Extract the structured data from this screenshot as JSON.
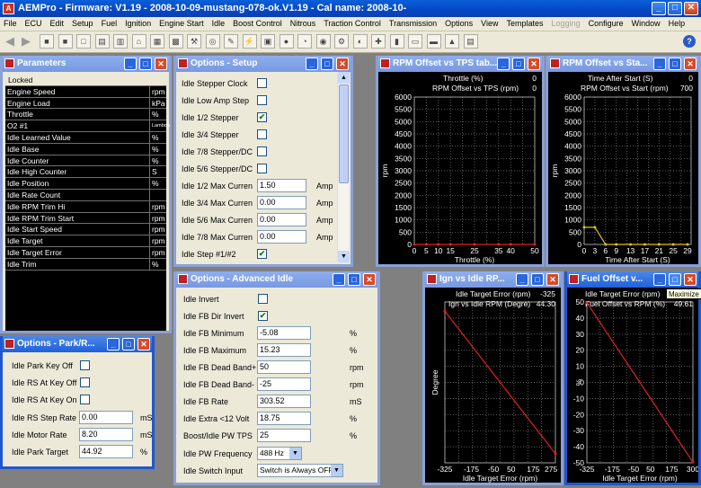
{
  "app": {
    "title": "AEMPro - Firmware: V1.19 - 2008-10-09-mustang-078-ok.V1.19 - Cal name: 2008-10-",
    "menu": [
      "File",
      "ECU",
      "Edit",
      "Setup",
      "Fuel",
      "Ignition",
      "Engine Start",
      "Idle",
      "Boost Control",
      "Nitrous",
      "Traction Control",
      "Transmission",
      "Options",
      "View",
      "Templates",
      "Logging",
      "Configure",
      "Window",
      "Help"
    ],
    "menu_disabled": "Logging",
    "tooltip": "Maximize"
  },
  "parameters": {
    "title": "Parameters",
    "header": "Locked",
    "rows": [
      {
        "name": "Engine Speed",
        "unit": "rpm"
      },
      {
        "name": "Engine Load",
        "unit": "kPa"
      },
      {
        "name": "Throttle",
        "unit": "%"
      },
      {
        "name": "O2 #1",
        "unit": "Lambda"
      },
      {
        "name": "Idle Learned Value",
        "unit": "%"
      },
      {
        "name": "Idle Base",
        "unit": "%"
      },
      {
        "name": "Idle Counter",
        "unit": "%"
      },
      {
        "name": "Idle High Counter",
        "unit": "S"
      },
      {
        "name": "Idle Position",
        "unit": "%"
      },
      {
        "name": "Idle Rate Count",
        "unit": ""
      },
      {
        "name": "Idle RPM Trim Hi",
        "unit": "rpm"
      },
      {
        "name": "Idle RPM Trim Start",
        "unit": "rpm"
      },
      {
        "name": "Idle Start Speed",
        "unit": "rpm"
      },
      {
        "name": "Idle Target",
        "unit": "rpm"
      },
      {
        "name": "Idle Target Error",
        "unit": "rpm"
      },
      {
        "name": "Idle Trim",
        "unit": "%"
      }
    ]
  },
  "setup": {
    "title": "Options - Setup",
    "checks": [
      {
        "label": "Idle Stepper Clock",
        "checked": ""
      },
      {
        "label": "Idle Low Amp Step",
        "checked": ""
      },
      {
        "label": "Idle 1/2 Stepper",
        "checked": "✔"
      },
      {
        "label": "Idle 3/4 Stepper",
        "checked": ""
      },
      {
        "label": "Idle 7/8 Stepper/DC",
        "checked": ""
      },
      {
        "label": "Idle 5/6 Stepper/DC",
        "checked": ""
      }
    ],
    "fields": [
      {
        "label": "Idle 1/2 Max Curren",
        "value": "1.50",
        "unit": "Amp"
      },
      {
        "label": "Idle 3/4 Max Curren",
        "value": "0.00",
        "unit": "Amp"
      },
      {
        "label": "Idle 5/6 Max Curren",
        "value": "0.00",
        "unit": "Amp"
      },
      {
        "label": "Idle 7/8 Max Curren",
        "value": "0.00",
        "unit": "Amp"
      }
    ],
    "last": {
      "label": "Idle Step #1/#2",
      "checked": "✔"
    }
  },
  "park": {
    "title": "Options - Park/R...",
    "checks": [
      {
        "label": "Idle Park Key Off",
        "checked": ""
      },
      {
        "label": "Idle RS At Key Off",
        "checked": ""
      },
      {
        "label": "Idle RS At Key On",
        "checked": ""
      }
    ],
    "fields": [
      {
        "label": "Idle RS Step Rate",
        "value": "0.00",
        "unit": "mS"
      },
      {
        "label": "Idle Motor Rate",
        "value": "8.20",
        "unit": "mS"
      },
      {
        "label": "Idle Park Target",
        "value": "44.92",
        "unit": "%"
      }
    ]
  },
  "advanced": {
    "title": "Options - Advanced Idle",
    "checks": [
      {
        "label": "Idle Invert",
        "checked": ""
      },
      {
        "label": "Idle FB Dir Invert",
        "checked": "✔"
      }
    ],
    "fields": [
      {
        "label": "Idle FB Minimum",
        "value": "-5.08",
        "unit": "%"
      },
      {
        "label": "Idle FB Maximum",
        "value": "15.23",
        "unit": "%"
      },
      {
        "label": "Idle FB Dead Band+",
        "value": "50",
        "unit": "rpm"
      },
      {
        "label": "Idle FB Dead Band-",
        "value": "-25",
        "unit": "rpm"
      },
      {
        "label": "Idle FB Rate",
        "value": "303.52",
        "unit": "mS"
      },
      {
        "label": "Idle Extra <12 Volt",
        "value": "18.75",
        "unit": "%"
      },
      {
        "label": "Boost/Idle PW TPS",
        "value": "25",
        "unit": "%"
      }
    ],
    "freq": {
      "label": "Idle PW Frequency",
      "value": "488 Hz"
    },
    "switch": {
      "label": "Idle Switch Input",
      "value": "Switch is Always OFF"
    }
  },
  "charts": {
    "rpm_tps": {
      "title": "RPM Offset vs TPS tab...",
      "top_label": "Throttle (%)",
      "top_value": "0",
      "sub_label": "RPM Offset vs TPS (rpm)",
      "sub_value": "0",
      "ylabel": "rpm",
      "xlabel": "Throttle (%)",
      "yticks": [
        "6000",
        "5500",
        "5000",
        "4500",
        "4000",
        "3500",
        "3000",
        "2500",
        "2000",
        "1500",
        "1000",
        "500",
        "0"
      ],
      "xticks": [
        "0",
        "5",
        "10",
        "15",
        "25",
        "35",
        "40",
        "50"
      ]
    },
    "rpm_start": {
      "title": "RPM Offset vs Sta...",
      "top_label": "Time After Start (S)",
      "top_value": "0",
      "sub_label": "RPM Offset vs Start (rpm)",
      "sub_value": "700",
      "ylabel": "rpm",
      "xlabel": "Time After Start (S)",
      "yticks": [
        "6000",
        "5500",
        "5000",
        "4500",
        "4000",
        "3500",
        "3000",
        "2500",
        "2000",
        "1500",
        "1000",
        "500",
        "0"
      ],
      "xticks": [
        "0",
        "3",
        "6",
        "9",
        "13",
        "17",
        "21",
        "25",
        "29"
      ]
    },
    "ign": {
      "title": "Ign vs Idle RP...",
      "top_label": "Idle Target Error (rpm)",
      "top_value": "-325",
      "sub_label": "Ign vs Idle RPM (Degre)",
      "sub_value": "44.30",
      "ylabel": "Degree",
      "xlabel": "Idle Target Error (rpm)",
      "xticks": [
        "-325",
        "-175",
        "-50",
        "50",
        "175",
        "275"
      ]
    },
    "fuel": {
      "title": "Fuel Offset v...",
      "top_label": "Idle Target Error (rpm)",
      "top_value": "-325",
      "sub_label": "Fuel Offset vs RPM (%)",
      "sub_value": "49.61",
      "ylabel": "%",
      "xlabel": "Idle Target Error (rpm)",
      "yticks": [
        "50",
        "40",
        "30",
        "20",
        "10",
        "0",
        "-10",
        "-20",
        "-30",
        "-40",
        "-50"
      ],
      "xticks": [
        "-325",
        "-175",
        "-50",
        "50",
        "175",
        "300"
      ]
    }
  },
  "chart_data": [
    {
      "type": "line",
      "title": "RPM Offset vs TPS tab...",
      "xlabel": "Throttle (%)",
      "ylabel": "rpm",
      "ylim": [
        0,
        6000
      ],
      "xlim": [
        0,
        50
      ],
      "series": [
        {
          "x": [
            0,
            5,
            10,
            15,
            25,
            35,
            40,
            50
          ],
          "values": [
            0,
            0,
            0,
            0,
            0,
            0,
            0,
            0
          ]
        }
      ]
    },
    {
      "type": "line",
      "title": "RPM Offset vs Sta...",
      "xlabel": "Time After Start (S)",
      "ylabel": "rpm",
      "ylim": [
        0,
        6000
      ],
      "xlim": [
        0,
        30
      ],
      "series": [
        {
          "x": [
            0,
            3,
            6,
            9,
            13,
            17,
            21,
            25,
            29
          ],
          "values": [
            700,
            700,
            0,
            0,
            0,
            0,
            0,
            0,
            0
          ]
        }
      ]
    },
    {
      "type": "line",
      "title": "Ign vs Idle RP...",
      "xlabel": "Idle Target Error (rpm)",
      "ylabel": "Degree",
      "xlim": [
        -325,
        300
      ],
      "ylim": [
        -50,
        50
      ],
      "series": [
        {
          "x": [
            -325,
            300
          ],
          "values": [
            44.3,
            -44.3
          ]
        }
      ]
    },
    {
      "type": "line",
      "title": "Fuel Offset v...",
      "xlabel": "Idle Target Error (rpm)",
      "ylabel": "%",
      "xlim": [
        -325,
        300
      ],
      "ylim": [
        -50,
        50
      ],
      "series": [
        {
          "x": [
            -325,
            300
          ],
          "values": [
            49.61,
            -49.61
          ]
        }
      ]
    }
  ]
}
